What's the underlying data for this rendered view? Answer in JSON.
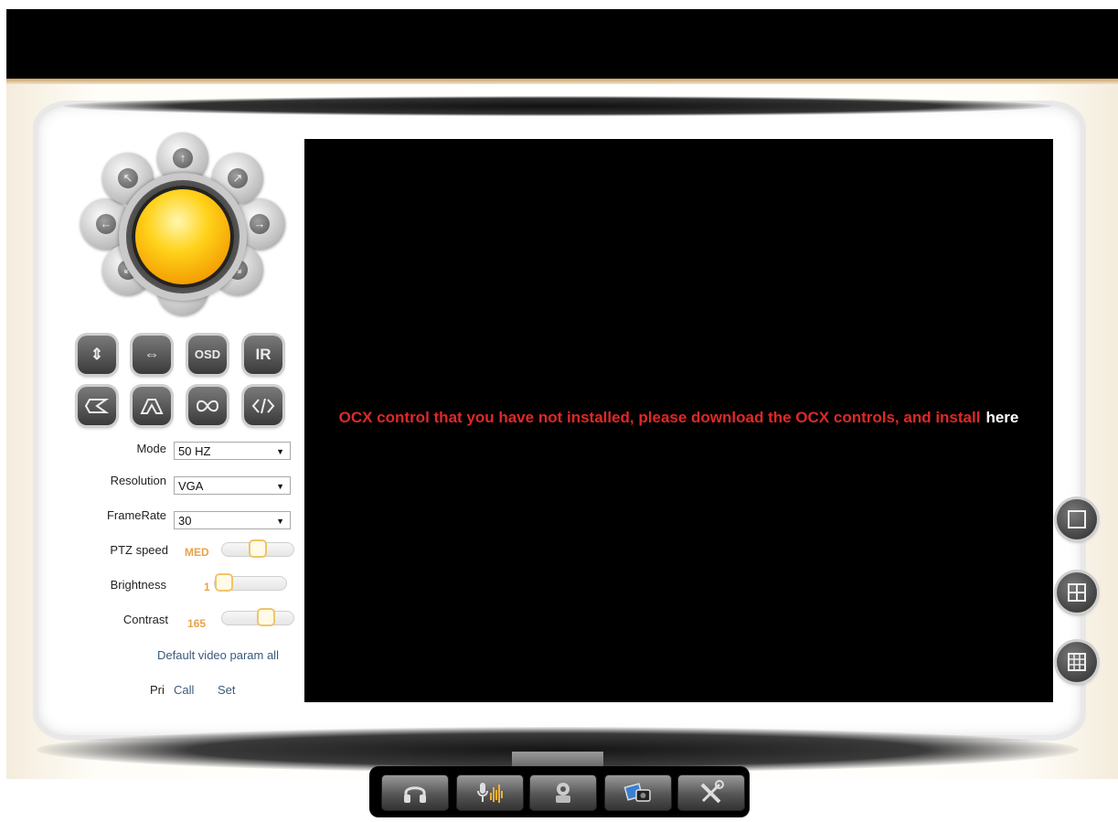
{
  "video": {
    "message": "OCX control that you have not installed, please download the OCX controls, and install",
    "link_text": "here"
  },
  "ptz": {
    "up": "up-arrow",
    "down": "down-arrow",
    "left": "left-arrow",
    "right": "right-arrow",
    "up_left": "up-left-arrow",
    "up_right": "up-right-arrow",
    "down_left": "down-left-arrow",
    "down_right": "down-right-arrow"
  },
  "buttons": {
    "vertical_flip": "⇕",
    "horizontal_flip": "⇔",
    "osd": "OSD",
    "ir": "IR"
  },
  "form": {
    "mode_label": "Mode",
    "mode_value": "50 HZ",
    "resolution_label": "Resolution",
    "resolution_value": "VGA",
    "framerate_label": "FrameRate",
    "framerate_value": "30",
    "ptz_speed_label": "PTZ speed",
    "ptz_speed_value": "MED",
    "ptz_speed_level": 0.5,
    "brightness_label": "Brightness",
    "brightness_value": "1",
    "brightness_level": 0.0,
    "contrast_label": "Contrast",
    "contrast_value": "165",
    "contrast_level": 0.65
  },
  "links": {
    "default_video": "Default video param all",
    "pri": "Pri",
    "call": "Call",
    "set": "Set"
  },
  "colors": {
    "message_red": "#e02828",
    "value_orange": "#e8a24a",
    "link_blue": "#3a5a7a"
  },
  "view_buttons": [
    "single-view-icon",
    "quad-view-icon",
    "nine-view-icon"
  ],
  "toolbar": [
    "headphones-icon",
    "microphone-icon",
    "camera-record-icon",
    "snapshot-icon",
    "settings-tools-icon"
  ]
}
